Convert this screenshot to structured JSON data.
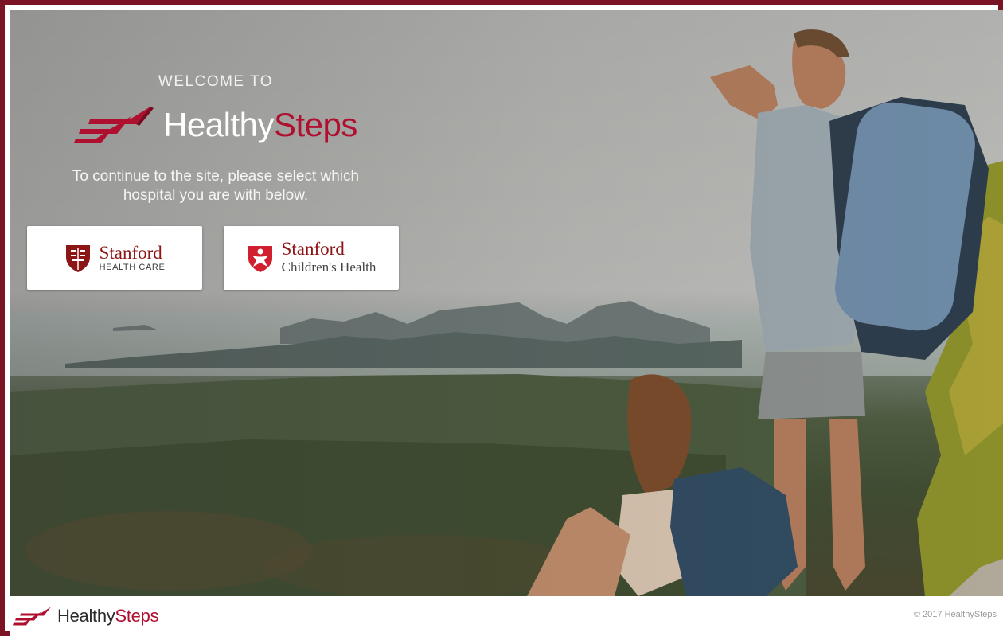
{
  "hero": {
    "welcome": "WELCOME TO",
    "brand_first": "Healthy",
    "brand_second": "Steps",
    "instruction_line1": "To continue to the site, please select which",
    "instruction_line2": "hospital you are with below."
  },
  "hospitals": [
    {
      "name": "Stanford",
      "subtitle": "HEALTH CARE",
      "icon": "stanford-shield-icon"
    },
    {
      "name": "Stanford",
      "subtitle": "Children's Health",
      "icon": "stanford-childrens-heart-icon"
    }
  ],
  "footer": {
    "brand_first": "Healthy",
    "brand_second": "Steps",
    "copyright": "© 2017 HealthySteps"
  },
  "colors": {
    "brand_red": "#b01030",
    "stanford_red": "#8c1515",
    "frame": "#7a1424"
  }
}
